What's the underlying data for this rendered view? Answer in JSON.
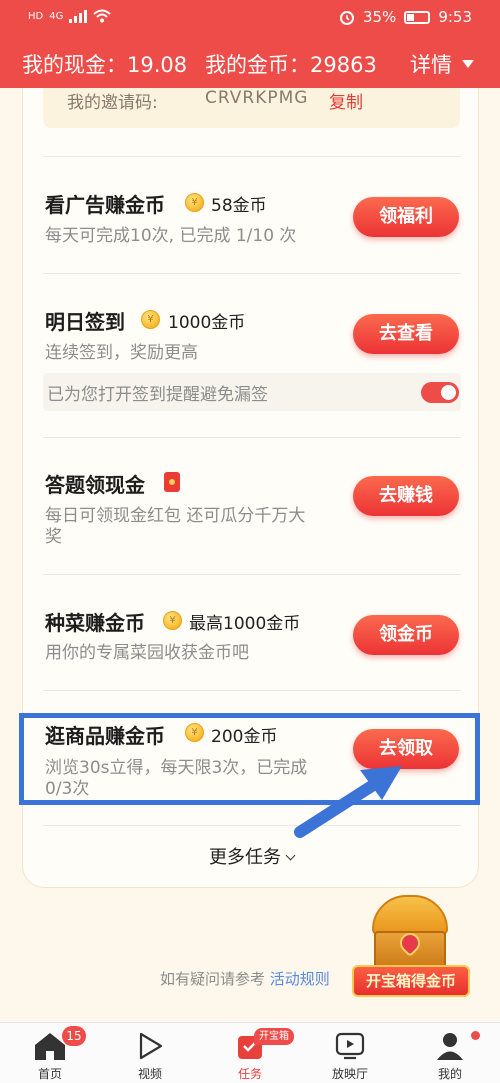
{
  "status_bar": {
    "network_label": "HD",
    "signal_label": "4G",
    "battery_text": "35%",
    "time": "9:53"
  },
  "header": {
    "cash_label": "我的现金：",
    "cash_value": "19.08",
    "coins_label": "我的金币：",
    "coins_value": "29863",
    "details_label": "详情"
  },
  "invite": {
    "label": "我的邀请码:",
    "code": "CRVRKPMG",
    "copy_label": "复制"
  },
  "tasks": [
    {
      "title": "看广告赚金币",
      "reward": "58金币",
      "desc": "每天可完成10次, 已完成 1/10 次",
      "button": "领福利",
      "coin_icon": "coin-icon"
    },
    {
      "title": "明日签到",
      "reward": "1000金币",
      "desc": "连续签到，奖励更高",
      "button": "去查看",
      "coin_icon": "coin-icon"
    },
    {
      "title": "答题领现金",
      "desc": "每日可领现金红包 还可瓜分千万大奖",
      "desc_line1": "每日可领现金红包 还可瓜分千万大",
      "desc_line2": "奖",
      "button": "去赚钱",
      "icon": "red-packet-icon"
    },
    {
      "title": "种菜赚金币",
      "reward": "最高1000金币",
      "desc": "用你的专属菜园收获金币吧",
      "button": "领金币",
      "coin_icon": "coin-icon"
    },
    {
      "title": "逛商品赚金币",
      "reward": "200金币",
      "desc_line1": "浏览30s立得，每天限3次，已完成",
      "desc_line2": "0/3次",
      "button": "去领取",
      "coin_icon": "coin-icon"
    }
  ],
  "sign_reminder": {
    "text": "已为您打开签到提醒避免漏签",
    "toggle_on": true
  },
  "more_tasks": "更多任务",
  "footer": {
    "note": "如有疑问请参考",
    "link": "活动规则"
  },
  "treasure_box": {
    "label": "开宝箱得金币"
  },
  "bottom_nav": [
    {
      "label": "首页",
      "icon": "home-icon",
      "badge": "15"
    },
    {
      "label": "视频",
      "icon": "play-icon"
    },
    {
      "label": "任务",
      "icon": "task-icon",
      "badge": "开宝箱",
      "active": true
    },
    {
      "label": "放映厅",
      "icon": "screening-icon"
    },
    {
      "label": "我的",
      "icon": "profile-icon",
      "dot": true
    }
  ],
  "colors": {
    "header_red": "#ee4c48",
    "button_red": "#ec3335",
    "highlight_blue": "#3c73d6",
    "link_blue": "#5a8ae0",
    "background": "#fdf7ec"
  }
}
